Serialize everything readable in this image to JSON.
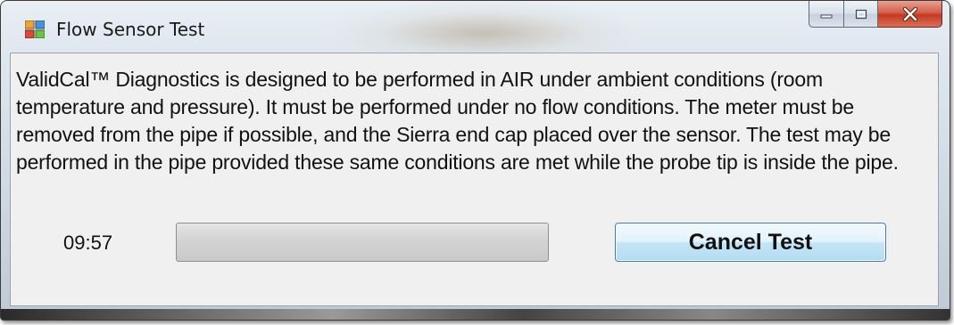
{
  "window": {
    "title": "Flow Sensor Test",
    "app_icon": "form-icon",
    "caption_buttons": [
      "minimize-icon",
      "maximize-icon",
      "close-icon"
    ]
  },
  "message": "ValidCal™ Diagnostics is designed to be performed in AIR under ambient conditions (room temperature and pressure). It must be performed under no flow conditions. The meter must be removed from the pipe if possible, and the Sierra end cap placed over the sensor. The test may be performed in the pipe provided these same conditions are met while the probe tip is inside the pipe.",
  "timer": "09:57",
  "progress": {
    "fraction": 0.0
  },
  "actions": {
    "cancel_label": "Cancel Test"
  },
  "colors": {
    "close_button": "#c43a22",
    "button_border": "#3c7fb1",
    "content_background": "#f0f0f0"
  }
}
